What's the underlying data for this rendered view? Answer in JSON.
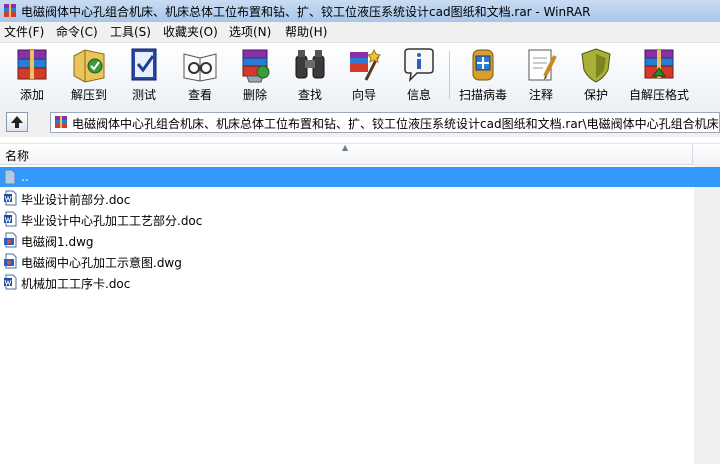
{
  "window": {
    "title": "电磁阀体中心孔组合机床、机床总体工位布置和钻、扩、铰工位液压系统设计cad图纸和文档.rar - WinRAR",
    "icon": "winrar-books-icon"
  },
  "menu": [
    {
      "label": "文件(F)"
    },
    {
      "label": "命令(C)"
    },
    {
      "label": "工具(S)"
    },
    {
      "label": "收藏夹(O)"
    },
    {
      "label": "选项(N)"
    },
    {
      "label": "帮助(H)"
    }
  ],
  "toolbar": [
    {
      "label": "添加",
      "icon": "add-archive-icon"
    },
    {
      "label": "解压到",
      "icon": "extract-to-icon"
    },
    {
      "label": "测试",
      "icon": "test-icon"
    },
    {
      "label": "查看",
      "icon": "view-icon"
    },
    {
      "label": "删除",
      "icon": "delete-icon"
    },
    {
      "label": "查找",
      "icon": "find-icon"
    },
    {
      "label": "向导",
      "icon": "wizard-icon"
    },
    {
      "label": "信息",
      "icon": "info-icon"
    },
    {
      "label": "扫描病毒",
      "icon": "virus-scan-icon"
    },
    {
      "label": "注释",
      "icon": "comment-icon"
    },
    {
      "label": "保护",
      "icon": "protect-icon"
    },
    {
      "label": "自解压格式",
      "icon": "sfx-icon"
    }
  ],
  "address": {
    "path": "电磁阀体中心孔组合机床、机床总体工位布置和钻、扩、铰工位液压系统设计cad图纸和文档.rar\\电磁阀体中心孔组合机床"
  },
  "columns": {
    "name": "名称"
  },
  "files": [
    {
      "name": "..",
      "icon": "parent-folder-icon",
      "selected": true
    },
    {
      "name": "毕业设计前部分.doc",
      "icon": "word-doc-icon"
    },
    {
      "name": "毕业设计中心孔加工工艺部分.doc",
      "icon": "word-doc-icon"
    },
    {
      "name": "电磁阀1.dwg",
      "icon": "dwg-file-icon"
    },
    {
      "name": "电磁阀中心孔加工示意图.dwg",
      "icon": "dwg-file-icon"
    },
    {
      "name": "机械加工工序卡.doc",
      "icon": "word-doc-icon"
    }
  ],
  "colors": {
    "selection": "#3399ff",
    "titlebar": "#b9d1ee"
  }
}
